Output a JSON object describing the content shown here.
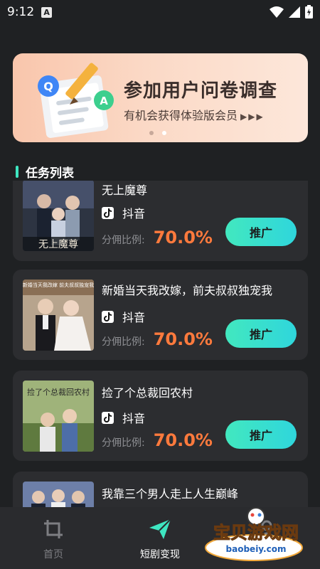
{
  "status": {
    "time": "9:12",
    "badge": "A"
  },
  "banner": {
    "title": "参加用户问卷调查",
    "subtitle": "有机会获得体验版会员",
    "arrows": "▶▶▶"
  },
  "carousel": {
    "count": 2,
    "active": 1
  },
  "section": {
    "title": "任务列表"
  },
  "tasks": [
    {
      "title": "无上魔尊",
      "platform": "抖音",
      "ratio_label": "分佣比例:",
      "ratio": "70.0%",
      "button": "推广",
      "poster_text": "无上魔尊"
    },
    {
      "title": "新婚当天我改嫁，前夫叔叔独宠我",
      "platform": "抖音",
      "ratio_label": "分佣比例:",
      "ratio": "70.0%",
      "button": "推广",
      "poster_text": "新婚当天我改嫁 前夫叔叔独宠我"
    },
    {
      "title": "捡了个总裁回农村",
      "platform": "抖音",
      "ratio_label": "分佣比例:",
      "ratio": "70.0%",
      "button": "推广",
      "poster_text": "捡了个总裁回农村"
    },
    {
      "title": "我靠三个男人走上人生巅峰"
    }
  ],
  "nav": {
    "items": [
      {
        "label": "首页",
        "icon": "crop-icon",
        "active": false
      },
      {
        "label": "短剧变现",
        "icon": "paper-plane-icon",
        "active": true
      },
      {
        "label": "",
        "icon": "user-icon",
        "active": false
      }
    ]
  },
  "watermark": {
    "text": "宝贝游戏网",
    "url": "baobeiy.com"
  },
  "colors": {
    "accent": "#3ee6c1",
    "ratio": "#ff7a3d",
    "background": "#1f2123",
    "card": "#2c2d30"
  }
}
